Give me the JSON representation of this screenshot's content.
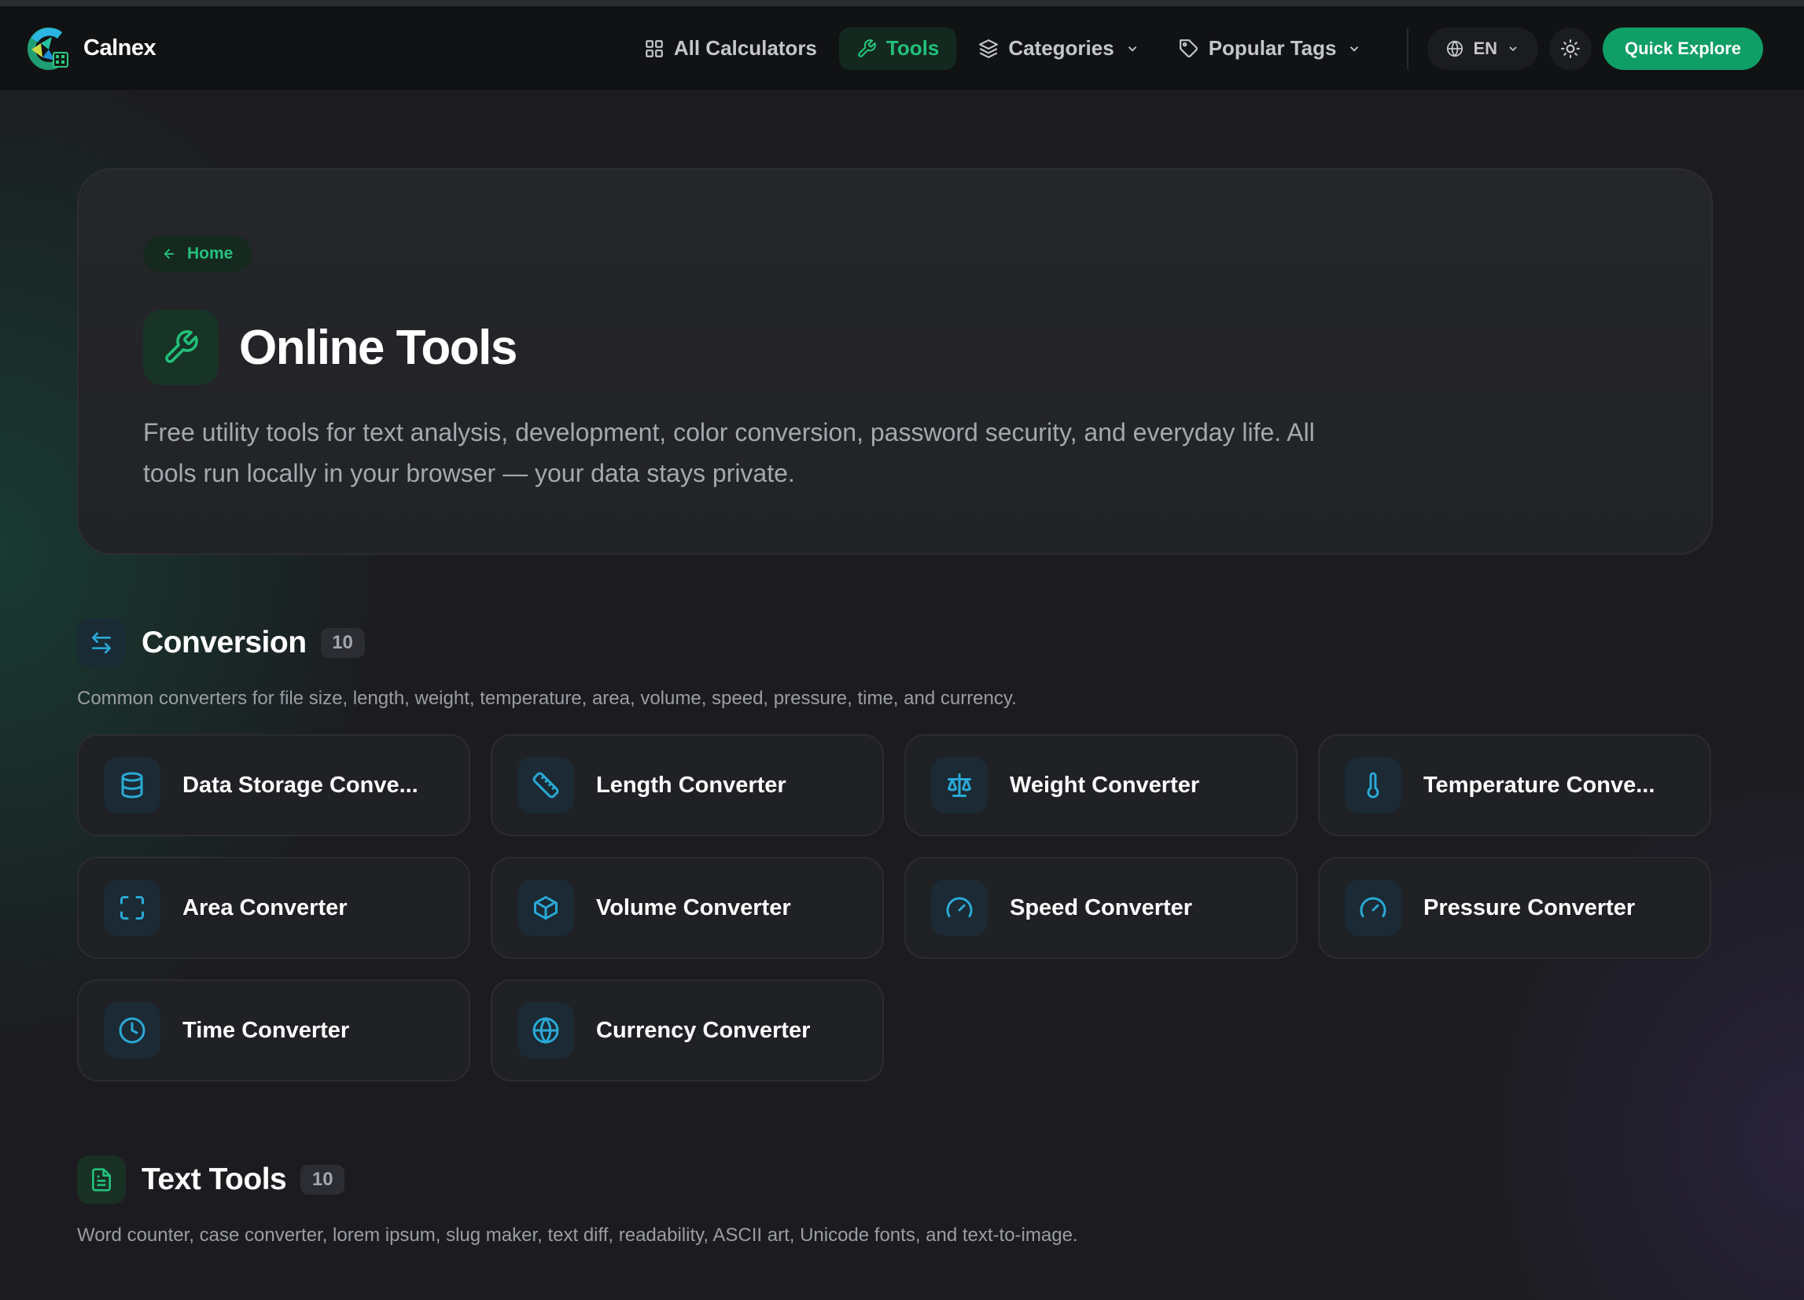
{
  "header": {
    "brand": "Calnex",
    "nav": [
      {
        "label": "All Calculators",
        "icon": "grid-icon",
        "active": false
      },
      {
        "label": "Tools",
        "icon": "wrench-icon",
        "active": true
      },
      {
        "label": "Categories",
        "icon": "layers-icon",
        "dropdown": true
      },
      {
        "label": "Popular Tags",
        "icon": "tag-icon",
        "dropdown": true
      }
    ],
    "language": "EN",
    "cta_label": "Quick Explore"
  },
  "hero": {
    "breadcrumb": "Home",
    "title": "Online Tools",
    "description": "Free utility tools for text analysis, development, color conversion, password security, and everyday life. All tools run locally in your browser — your data stays private."
  },
  "sections": [
    {
      "title": "Conversion",
      "count": "10",
      "icon": "arrows-swap-icon",
      "description": "Common converters for file size, length, weight, temperature, area, volume, speed, pressure, time, and currency.",
      "tools": [
        {
          "label": "Data Storage Conve...",
          "icon": "database-icon"
        },
        {
          "label": "Length Converter",
          "icon": "ruler-icon"
        },
        {
          "label": "Weight Converter",
          "icon": "scale-icon"
        },
        {
          "label": "Temperature Conve...",
          "icon": "thermometer-icon"
        },
        {
          "label": "Area Converter",
          "icon": "area-frame-icon"
        },
        {
          "label": "Volume Converter",
          "icon": "cube-icon"
        },
        {
          "label": "Speed Converter",
          "icon": "gauge-icon"
        },
        {
          "label": "Pressure Converter",
          "icon": "gauge-icon"
        },
        {
          "label": "Time Converter",
          "icon": "clock-icon"
        },
        {
          "label": "Currency Converter",
          "icon": "globe-icon"
        }
      ]
    },
    {
      "title": "Text Tools",
      "count": "10",
      "icon": "document-icon",
      "description": "Word counter, case converter, lorem ipsum, slug maker, text diff, readability, ASCII art, Unicode fonts, and text-to-image."
    }
  ],
  "colors": {
    "accent_green": "#22c07a",
    "cta_green": "#0e9e66",
    "icon_blue": "#2aa9d6",
    "background": "#1c1c20"
  }
}
